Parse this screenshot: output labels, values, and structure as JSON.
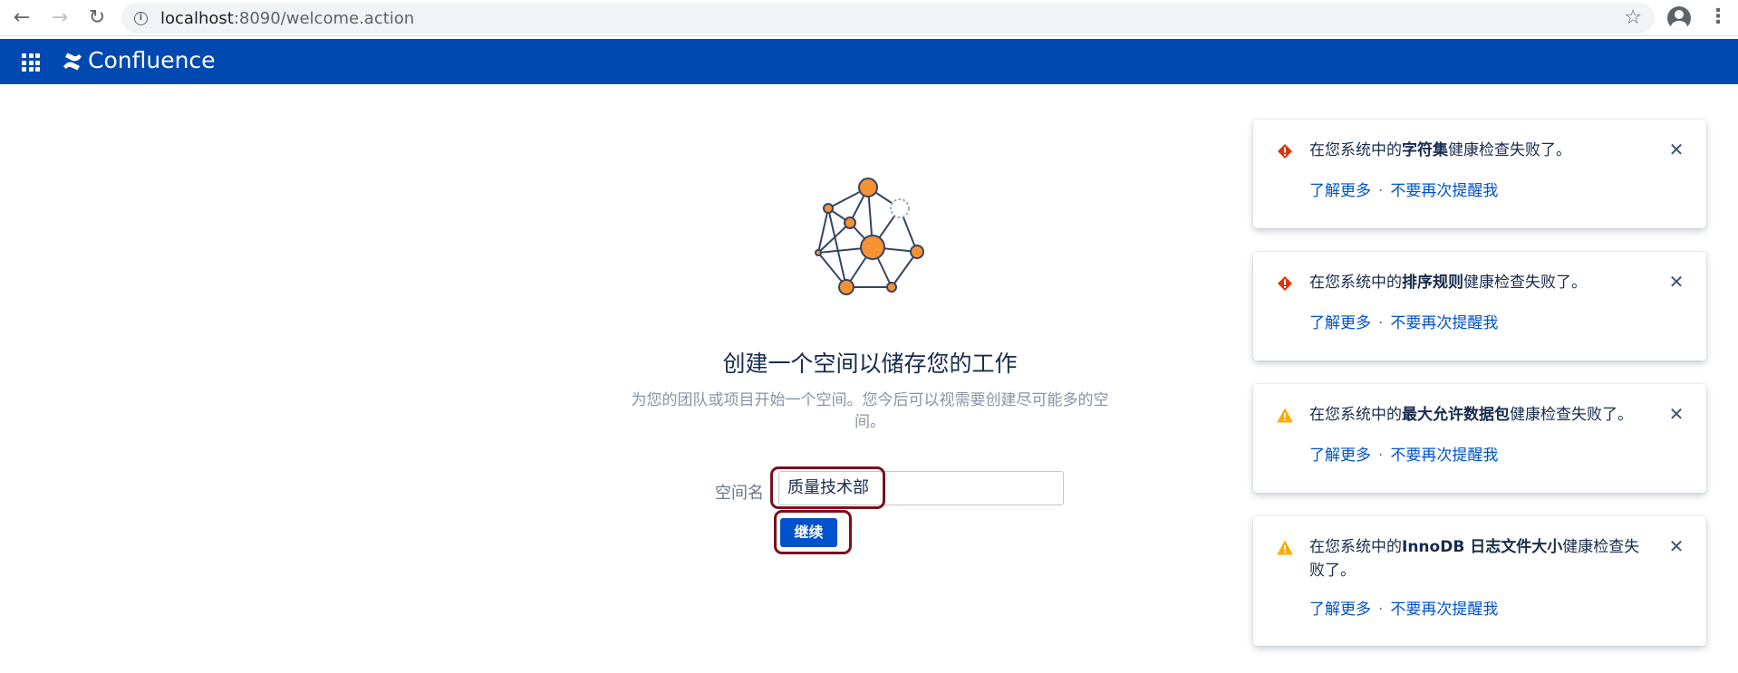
{
  "browser": {
    "url_host": "localhost",
    "url_path": ":8090/welcome.action",
    "back_icon": "back-arrow-icon",
    "forward_icon": "forward-arrow-icon",
    "reload_icon": "reload-icon",
    "bookmark_icon": "star-icon"
  },
  "header": {
    "app_name": "Confluence",
    "bg_color": "#0049b0"
  },
  "main": {
    "title": "创建一个空间以储存您的工作",
    "subtitle": "为您的团队或项目开始一个空间。您今后可以视需要创建尽可能多的空间。",
    "field_label": "空间名",
    "space_name_value": "质量技术部",
    "continue_label": "继续"
  },
  "notifications": [
    {
      "severity": "error",
      "prefix": "在您系统中的",
      "subject": "字符集",
      "suffix": "健康检查失败了。",
      "learn_more": "了解更多",
      "dismiss": "不要再次提醒我"
    },
    {
      "severity": "error",
      "prefix": "在您系统中的",
      "subject": "排序规则",
      "suffix": "健康检查失败了。",
      "learn_more": "了解更多",
      "dismiss": "不要再次提醒我"
    },
    {
      "severity": "warning",
      "prefix": "在您系统中的",
      "subject": "最大允许数据包",
      "suffix": "健康检查失败了。",
      "learn_more": "了解更多",
      "dismiss": "不要再次提醒我"
    },
    {
      "severity": "warning",
      "prefix": "在您系统中的",
      "subject": "InnoDB 日志文件大小",
      "suffix": "健康检查失败了。",
      "learn_more": "了解更多",
      "dismiss": "不要再次提醒我"
    }
  ],
  "colors": {
    "error": "#de350b",
    "warning": "#ffab00",
    "link": "#0052cc",
    "highlight": "#7a0f1c",
    "node_fill": "#f79232"
  },
  "separator": "·"
}
